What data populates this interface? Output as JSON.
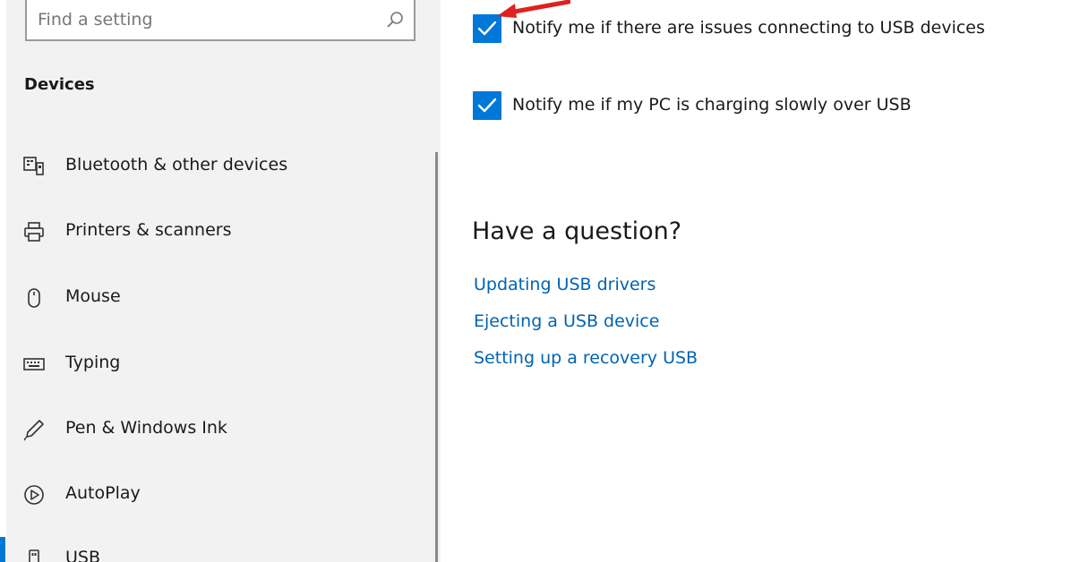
{
  "search": {
    "placeholder": "Find a setting"
  },
  "sidebar": {
    "section_title": "Devices",
    "items": [
      {
        "label": "Bluetooth & other devices",
        "icon": "bluetooth-devices-icon"
      },
      {
        "label": "Printers & scanners",
        "icon": "printer-icon"
      },
      {
        "label": "Mouse",
        "icon": "mouse-icon"
      },
      {
        "label": "Typing",
        "icon": "keyboard-icon"
      },
      {
        "label": "Pen & Windows Ink",
        "icon": "pen-icon"
      },
      {
        "label": "AutoPlay",
        "icon": "autoplay-icon"
      },
      {
        "label": "USB",
        "icon": "usb-icon",
        "selected": true
      }
    ]
  },
  "main": {
    "checkboxes": [
      {
        "label": "Notify me if there are issues connecting to USB devices",
        "checked": true
      },
      {
        "label": "Notify me if my PC is charging slowly over USB",
        "checked": true
      }
    ],
    "question_heading": "Have a question?",
    "links": [
      "Updating USB drivers",
      "Ejecting a USB device",
      "Setting up a recovery USB"
    ]
  },
  "colors": {
    "accent": "#0078d7",
    "link": "#0063b1",
    "sidebar_bg": "#f2f2f2",
    "annotation_arrow": "#e02020"
  }
}
